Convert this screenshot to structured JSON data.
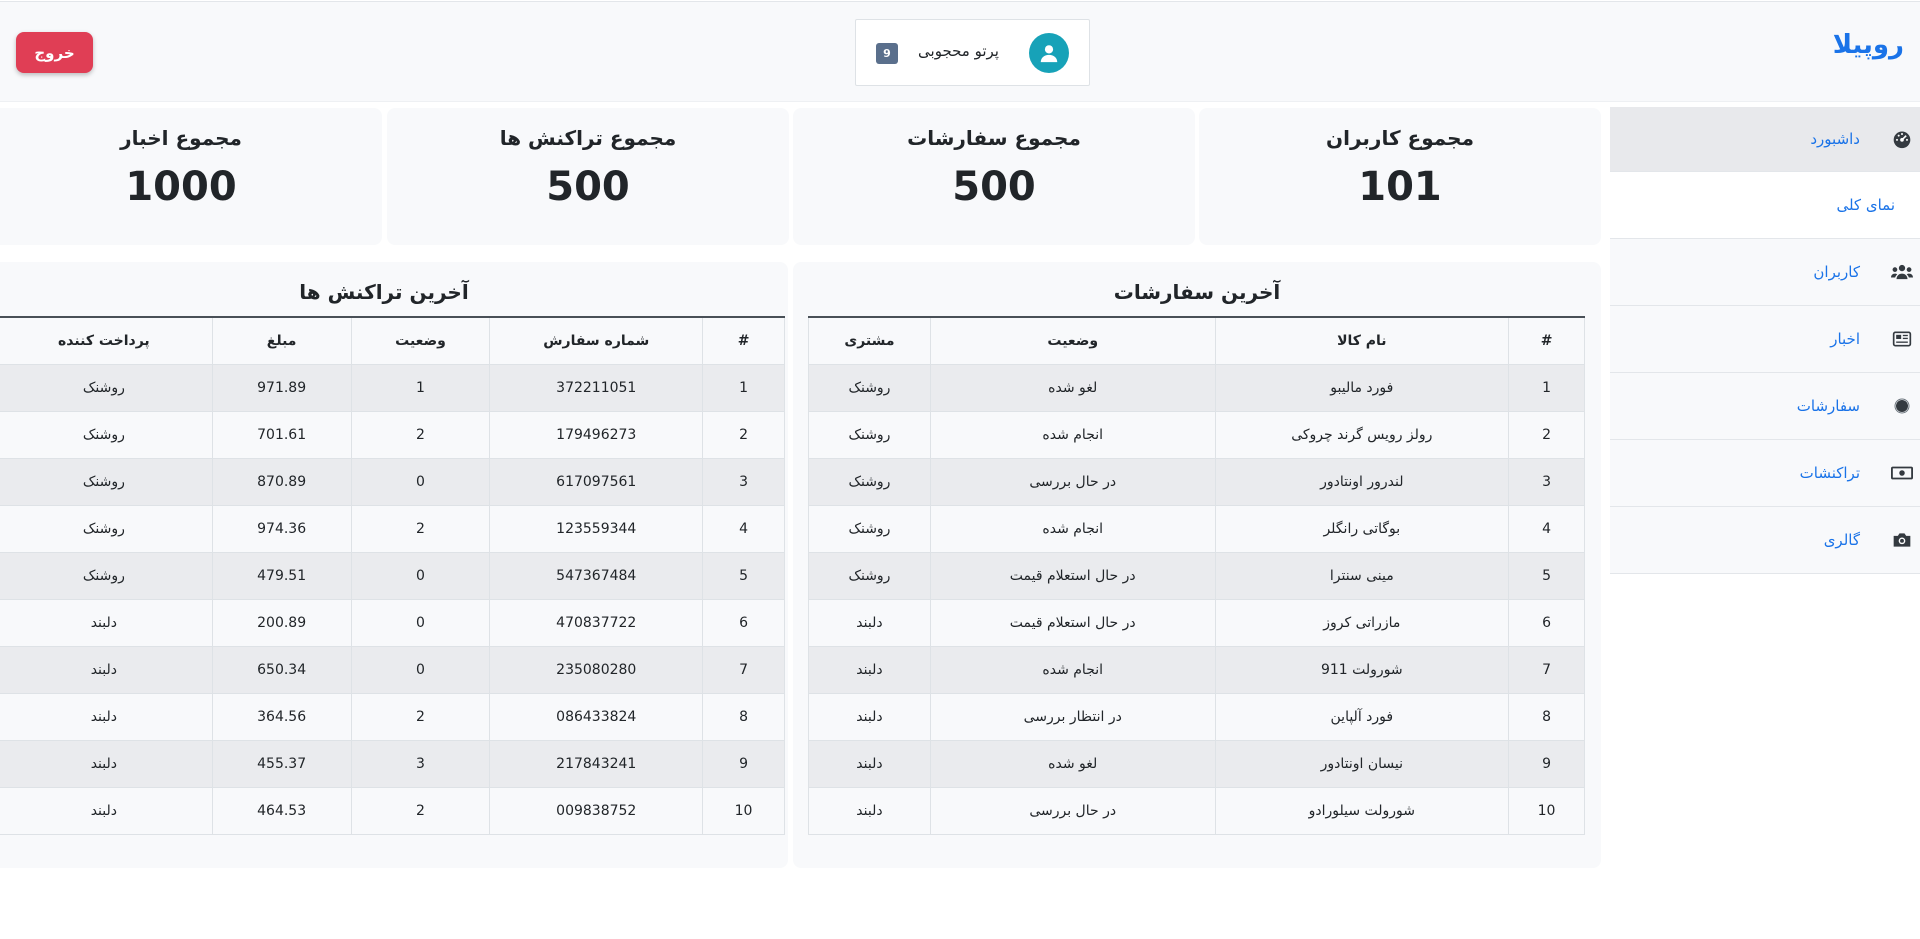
{
  "header": {
    "brand": "روپیلا",
    "user_name": "پرتو محجوبی",
    "user_badge": "9",
    "logout_label": "خروج"
  },
  "sidebar": {
    "items": [
      {
        "label": "داشبورد",
        "icon": "dashboard-icon"
      },
      {
        "label": "نمای کلی",
        "icon": ""
      },
      {
        "label": "کاربران",
        "icon": "users-icon"
      },
      {
        "label": "اخبار",
        "icon": "newspaper-icon"
      },
      {
        "label": "سفارشات",
        "icon": "circle-icon"
      },
      {
        "label": "تراکنشات",
        "icon": "money-bill-icon"
      },
      {
        "label": "گالری",
        "icon": "camera-icon"
      }
    ]
  },
  "stats": [
    {
      "label": "مجموع کاربران",
      "value": "101"
    },
    {
      "label": "مجموع سفارشات",
      "value": "500"
    },
    {
      "label": "مجموع تراکنش ها",
      "value": "500"
    },
    {
      "label": "مجموع اخبار",
      "value": "1000"
    }
  ],
  "orders": {
    "title": "آخرین سفارشات",
    "headers": [
      "#",
      "نام کالا",
      "وضعیت",
      "مشتری"
    ],
    "rows": [
      [
        "1",
        "فورد مالیبو",
        "لغو شده",
        "روشنک"
      ],
      [
        "2",
        "رولز رویس گرند چروکی",
        "انجام شده",
        "روشنک"
      ],
      [
        "3",
        "لندرور اونتادور",
        "در حال بررسی",
        "روشنک"
      ],
      [
        "4",
        "بوگاتی رانگلر",
        "انجام شده",
        "روشنک"
      ],
      [
        "5",
        "مینی سنترا",
        "در حال استعلام قیمت",
        "روشنک"
      ],
      [
        "6",
        "مازراتی کروز",
        "در حال استعلام قیمت",
        "دلبند"
      ],
      [
        "7",
        "شورولت 911",
        "انجام شده",
        "دلبند"
      ],
      [
        "8",
        "فورد آلپاین",
        "در انتظار بررسی",
        "دلبند"
      ],
      [
        "9",
        "نیسان اونتادور",
        "لغو شده",
        "دلبند"
      ],
      [
        "10",
        "شورولت سیلورادو",
        "در حال بررسی",
        "دلبند"
      ]
    ]
  },
  "transactions": {
    "title": "آخرین تراکنش ها",
    "headers": [
      "#",
      "شماره سفارش",
      "وضعیت",
      "مبلغ",
      "پرداخت کننده"
    ],
    "rows": [
      [
        "1",
        "372211051",
        "1",
        "971.89",
        "روشنک"
      ],
      [
        "2",
        "179496273",
        "2",
        "701.61",
        "روشنک"
      ],
      [
        "3",
        "617097561",
        "0",
        "870.89",
        "روشنک"
      ],
      [
        "4",
        "123559344",
        "2",
        "974.36",
        "روشنک"
      ],
      [
        "5",
        "547367484",
        "0",
        "479.51",
        "روشنک"
      ],
      [
        "6",
        "470837722",
        "0",
        "200.89",
        "دلبند"
      ],
      [
        "7",
        "235080280",
        "0",
        "650.34",
        "دلبند"
      ],
      [
        "8",
        "086433824",
        "2",
        "364.56",
        "دلبند"
      ],
      [
        "9",
        "217843241",
        "3",
        "455.37",
        "دلبند"
      ],
      [
        "10",
        "009838752",
        "2",
        "464.53",
        "دلبند"
      ]
    ]
  },
  "colors": {
    "brand": "#1a73e8",
    "logout": "#e03e55",
    "avatar": "#17a2b8",
    "badge": "#5a6f8c"
  }
}
